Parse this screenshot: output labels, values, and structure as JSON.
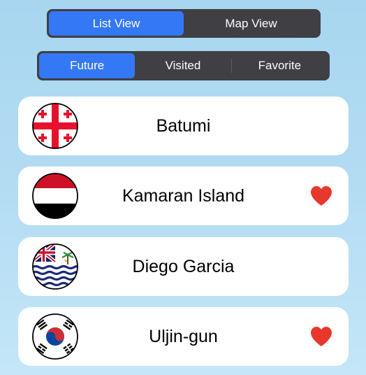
{
  "view_toggle": {
    "options": [
      "List View",
      "Map View"
    ],
    "selected": "List View"
  },
  "filter_tabs": {
    "options": [
      "Future",
      "Visited",
      "Favorite"
    ],
    "selected": "Future"
  },
  "places": [
    {
      "name": "Batumi",
      "flag": "georgia-flag-icon",
      "favorite": false
    },
    {
      "name": "Kamaran Island",
      "flag": "yemen-flag-icon",
      "favorite": true
    },
    {
      "name": "Diego Garcia",
      "flag": "british-indian-ocean-territory-flag-icon",
      "favorite": false
    },
    {
      "name": "Uljin-gun",
      "flag": "south-korea-flag-icon",
      "favorite": true
    }
  ],
  "colors": {
    "accent": "#3478f6",
    "segment_bg": "#3f3f44",
    "heart": "#e8372c",
    "background": "#b3dcf3"
  }
}
